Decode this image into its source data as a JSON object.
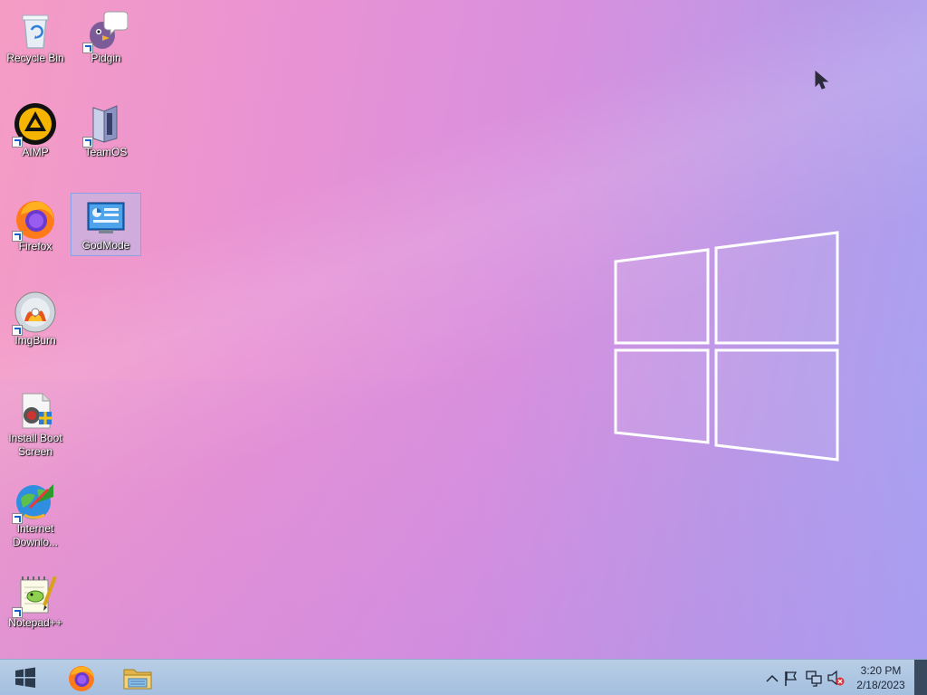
{
  "desktop": {
    "icons": [
      {
        "label": "Recycle Bin",
        "icon": "recycle-bin-icon"
      },
      {
        "label": "Pidgin",
        "icon": "pidgin-icon"
      },
      {
        "label": "AIMP",
        "icon": "aimp-icon"
      },
      {
        "label": "TeamOS",
        "icon": "teamos-icon"
      },
      {
        "label": "Firefox",
        "icon": "firefox-icon"
      },
      {
        "label": "GodMode",
        "icon": "godmode-icon",
        "selected": true
      },
      {
        "label": "ImgBurn",
        "icon": "imgburn-icon"
      },
      {
        "label": "Install Boot Screen",
        "icon": "install-boot-screen-icon"
      },
      {
        "label": "Internet Downlo...",
        "icon": "internet-download-manager-icon"
      },
      {
        "label": "Notepad++",
        "icon": "notepadpp-icon"
      }
    ]
  },
  "taskbar": {
    "pinned": [
      {
        "name": "start-button",
        "icon": "windows-logo-icon"
      },
      {
        "name": "firefox",
        "icon": "firefox-icon"
      },
      {
        "name": "file-explorer",
        "icon": "folder-icon"
      }
    ],
    "tray": {
      "icons": [
        "chevron-up-icon",
        "flag-icon",
        "network-icon",
        "volume-muted-icon"
      ],
      "time": "3:20 PM",
      "date": "2/18/2023"
    }
  },
  "colors": {
    "taskbar": "#b9cee6",
    "wallpaper_left": "#f59cc4",
    "wallpaper_right": "#a6a3f2"
  }
}
